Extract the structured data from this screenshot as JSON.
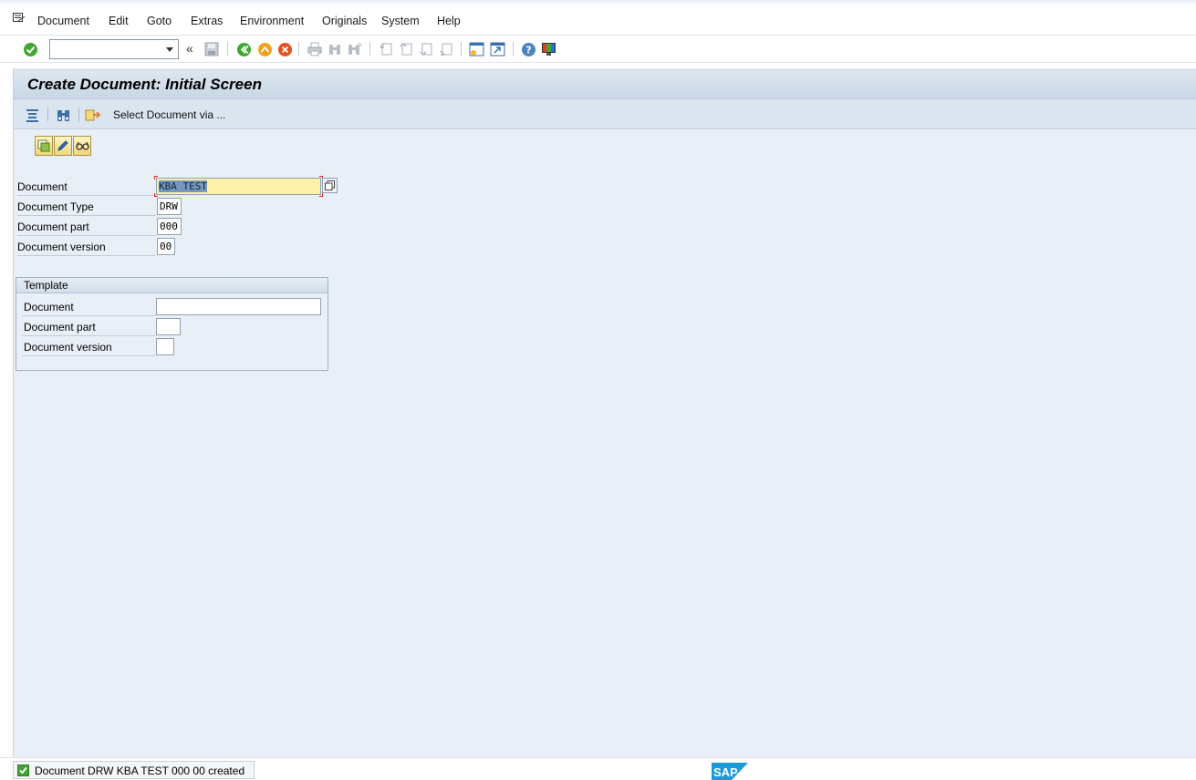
{
  "menubar": {
    "items": [
      "Document",
      "Edit",
      "Goto",
      "Extras",
      "Environment",
      "Originals",
      "System",
      "Help"
    ]
  },
  "toolbar": {
    "command_field_value": "",
    "icons": [
      "enter-icon",
      "command-dropdown-icon",
      "collapse-icon",
      "save-icon",
      "back-icon",
      "exit-icon",
      "cancel-icon",
      "print-icon",
      "find-icon",
      "find-next-icon",
      "first-page-icon",
      "previous-page-icon",
      "next-page-icon",
      "last-page-icon",
      "new-session-icon",
      "create-shortcut-icon",
      "help-icon",
      "customize-layout-icon"
    ]
  },
  "title": "Create Document: Initial Screen",
  "app_toolbar": {
    "select_via_label": "Select Document via ..."
  },
  "fields": {
    "document_label": "Document",
    "document_value": "KBA TEST",
    "document_type_label": "Document Type",
    "document_type_value": "DRW",
    "document_part_label": "Document part",
    "document_part_value": "000",
    "document_version_label": "Document version",
    "document_version_value": "00"
  },
  "template": {
    "title": "Template",
    "document_label": "Document",
    "document_value": "",
    "document_part_label": "Document part",
    "document_part_value": "",
    "document_version_label": "Document version",
    "document_version_value": ""
  },
  "status": {
    "message": "Document DRW KBA TEST 000 00 created",
    "type": "success"
  },
  "brand": {
    "logo_text": "SAP",
    "accent": "#1a9bd7"
  }
}
